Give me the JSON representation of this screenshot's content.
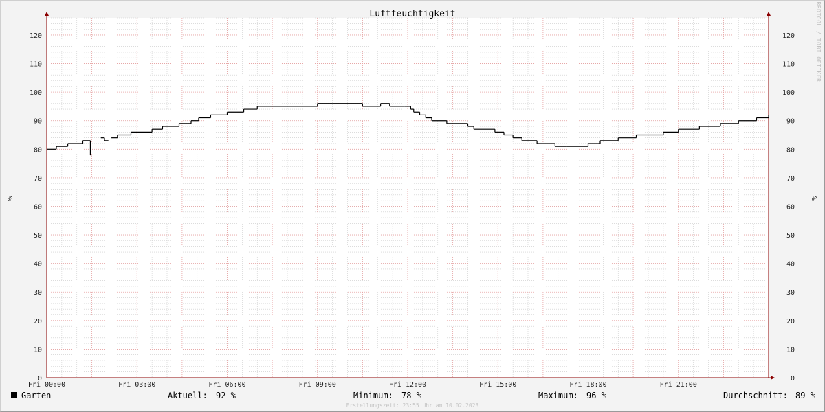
{
  "chart_data": {
    "type": "line",
    "title": "Luftfeuchtigkeit",
    "ylabel": "%",
    "ylim": [
      0,
      126
    ],
    "y_ticks": [
      0,
      10,
      20,
      30,
      40,
      50,
      60,
      70,
      80,
      90,
      100,
      110,
      120
    ],
    "x_tick_labels": [
      "Fri 00:00",
      "Fri 03:00",
      "Fri 06:00",
      "Fri 09:00",
      "Fri 12:00",
      "Fri 15:00",
      "Fri 18:00",
      "Fri 21:00"
    ],
    "x_ticks_hours": [
      0,
      3,
      6,
      9,
      12,
      15,
      18,
      21
    ],
    "xlim_hours": [
      0,
      24
    ],
    "grid": true,
    "step": true,
    "series": [
      {
        "name": "Garten",
        "color": "#000000",
        "x_hours": [
          0.0,
          0.32,
          0.7,
          1.2,
          1.45,
          1.5,
          1.8,
          1.92,
          2.05,
          2.15,
          2.35,
          2.8,
          3.5,
          3.85,
          4.4,
          4.8,
          5.05,
          5.45,
          6.0,
          6.55,
          7.0,
          7.5,
          8.0,
          8.5,
          9.0,
          9.5,
          10.5,
          11.1,
          11.4,
          11.9,
          12.1,
          12.2,
          12.4,
          12.6,
          12.8,
          13.3,
          14.0,
          14.2,
          14.9,
          15.2,
          15.5,
          15.8,
          16.3,
          16.9,
          17.3,
          18.0,
          18.4,
          19.0,
          19.6,
          20.0,
          20.5,
          21.0,
          21.7,
          22.4,
          23.0,
          23.6,
          24.0
        ],
        "y": [
          80,
          81,
          82,
          83,
          78,
          null,
          84,
          83,
          null,
          84,
          85,
          86,
          87,
          88,
          89,
          90,
          91,
          92,
          93,
          94,
          95,
          95,
          95,
          95,
          96,
          96,
          95,
          96,
          95,
          95,
          94,
          93,
          92,
          91,
          90,
          89,
          88,
          87,
          86,
          85,
          84,
          83,
          82,
          81,
          81,
          82,
          83,
          84,
          85,
          85,
          86,
          87,
          88,
          89,
          90,
          91,
          92
        ]
      }
    ],
    "legend": {
      "position": "bottom-left",
      "label": "Garten",
      "swatch_color": "#000000"
    },
    "stats": {
      "current_label": "Aktuell:",
      "current_value": "92 %",
      "min_label": "Minimum:",
      "min_value": "78 %",
      "max_label": "Maximum:",
      "max_value": "96 %",
      "avg_label": "Durchschnitt:",
      "avg_value": "89 %"
    },
    "footer": "Erstellungszeit: 23:55 Uhr am 10.02.2023",
    "watermark": "RRDTOOL / TOBI OETIKER",
    "colors": {
      "major_grid": "#e8a0a0",
      "minor_grid": "#c8c8c8",
      "axis": "#8b0000",
      "canvas": "#ffffff",
      "background": "#f3f3f3"
    }
  }
}
